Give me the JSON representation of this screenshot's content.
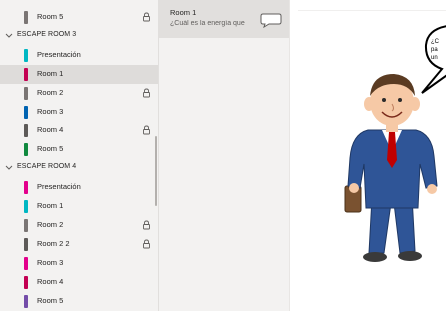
{
  "nav": {
    "rows": [
      {
        "kind": "page",
        "label": "Room 5",
        "color": "#7a7574",
        "locked": true
      },
      {
        "kind": "section",
        "label": "ESCAPE ROOM 3"
      },
      {
        "kind": "page",
        "label": "Presentación",
        "color": "#00b7c3",
        "locked": false
      },
      {
        "kind": "page",
        "label": "Room 1",
        "color": "#c30052",
        "locked": false,
        "selected": true
      },
      {
        "kind": "page",
        "label": "Room 2",
        "color": "#7a7574",
        "locked": true
      },
      {
        "kind": "page",
        "label": "Room 3",
        "color": "#0063b1",
        "locked": false
      },
      {
        "kind": "page",
        "label": "Room 4",
        "color": "#5d5a58",
        "locked": true
      },
      {
        "kind": "page",
        "label": "Room 5",
        "color": "#10893e",
        "locked": false
      },
      {
        "kind": "section",
        "label": "ESCAPE ROOM 4"
      },
      {
        "kind": "page",
        "label": "Presentación",
        "color": "#e3008c",
        "locked": false
      },
      {
        "kind": "page",
        "label": "Room 1",
        "color": "#00b7c3",
        "locked": false
      },
      {
        "kind": "page",
        "label": "Room 2",
        "color": "#7a7574",
        "locked": true
      },
      {
        "kind": "page",
        "label": "Room 2 2",
        "color": "#5d5a58",
        "locked": true
      },
      {
        "kind": "page",
        "label": "Room 3",
        "color": "#e3008c",
        "locked": false
      },
      {
        "kind": "page",
        "label": "Room 4",
        "color": "#c30052",
        "locked": false
      },
      {
        "kind": "page",
        "label": "Room 5",
        "color": "#744da9",
        "locked": false
      }
    ]
  },
  "page_list": {
    "title": "Room 1",
    "preview": "¿Cuál es la energía que"
  },
  "canvas": {
    "bubble_lines": [
      "¿C",
      "pa",
      "un"
    ]
  },
  "colors": {
    "suit": "#2f5597",
    "tie": "#c00000",
    "skin": "#f6c9a6",
    "hair": "#5a3b22"
  }
}
